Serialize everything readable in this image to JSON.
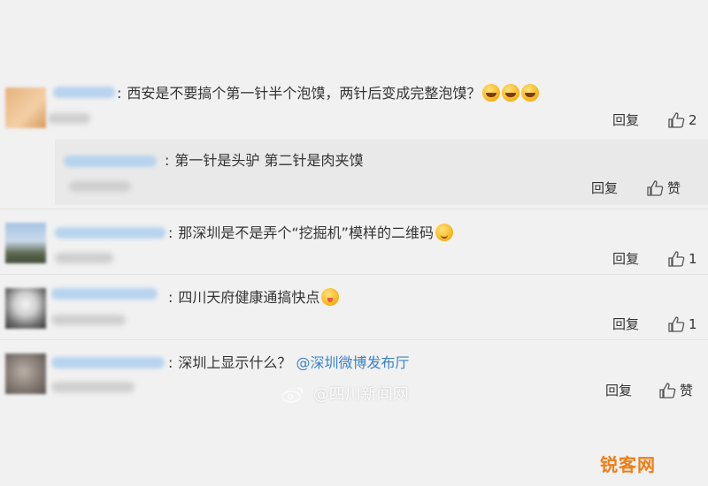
{
  "colors": {
    "mention": "#3b83c7",
    "logo": "#f07d16",
    "background": "#f1f1f1"
  },
  "comments": [
    {
      "text": "西安是不要搞个第一针半个泡馍，两针后变成完整泡馍？",
      "emojis": [
        "laugh",
        "laugh",
        "laugh"
      ],
      "reply_label": "回复",
      "like_count": "2",
      "reply": {
        "text": "第一针是头驴  第二针是肉夹馍",
        "reply_label": "回复",
        "like_label": "赞"
      }
    },
    {
      "text": "那深圳是不是弄个“挖掘机”模样的二维码",
      "emojis": [
        "smile"
      ],
      "reply_label": "回复",
      "like_count": "1"
    },
    {
      "text": "四川天府健康通搞快点",
      "emojis": [
        "yum"
      ],
      "reply_label": "回复",
      "like_count": "1"
    },
    {
      "text": "深圳上显示什么？",
      "mention": "@深圳微博发布厅",
      "reply_label": "回复",
      "like_label": "赞"
    }
  ],
  "watermark": "@四川新闻网",
  "logo_text": "锐客网"
}
